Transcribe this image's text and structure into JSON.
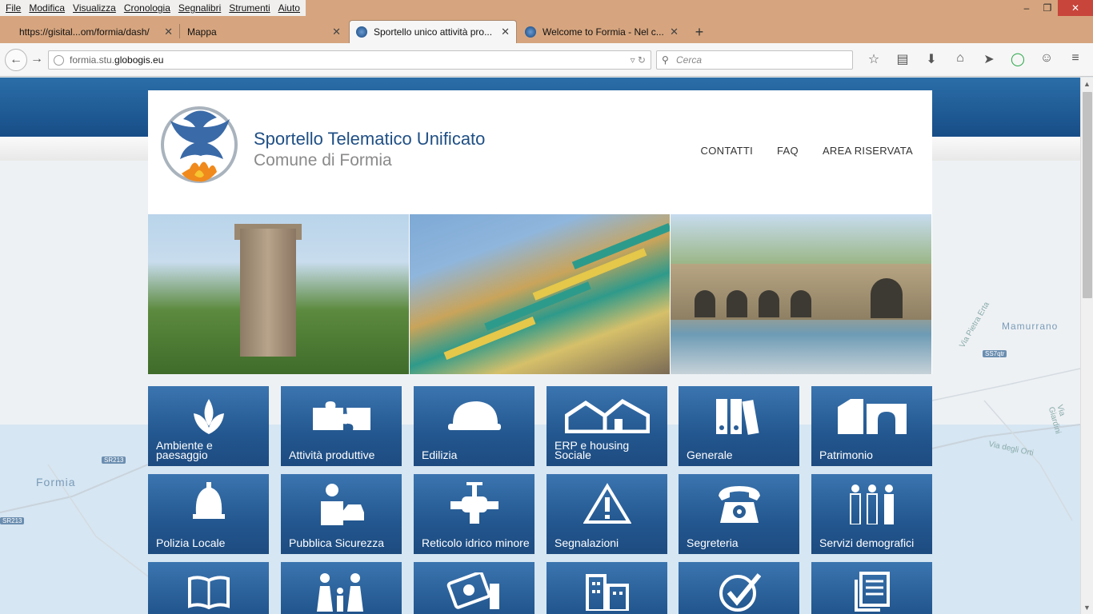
{
  "menu": [
    "File",
    "Modifica",
    "Visualizza",
    "Cronologia",
    "Segnalibri",
    "Strumenti",
    "Aiuto"
  ],
  "window_controls": {
    "minimize": "–",
    "maximize": "❐",
    "close": "✕"
  },
  "tabs": [
    {
      "title": "https://gisital...om/formia/dash/",
      "close": "✕"
    },
    {
      "title": "Mappa",
      "close": "✕"
    },
    {
      "title": "Sportello unico attività pro...",
      "close": "✕",
      "active": true
    },
    {
      "title": "Welcome to Formia - Nel c...",
      "close": "✕"
    }
  ],
  "newtab": "+",
  "nav": {
    "back": "←",
    "forward": "→",
    "url_prefix": "formia.stu.",
    "url_domain": "globogis.eu",
    "url_controls": "▿ ↻",
    "search_placeholder": "Cerca",
    "search_icon": "⚲",
    "toolbar_icons": [
      "☆",
      "▤",
      "⬇",
      "⌂",
      "➤",
      "◯",
      "☺",
      "≡"
    ]
  },
  "header": {
    "title": "Sportello Telematico Unificato",
    "subtitle": "Comune di Formia",
    "links": [
      "CONTATTI",
      "FAQ",
      "AREA RISERVATA"
    ]
  },
  "map_labels": {
    "formia": "Formia",
    "mamurrano": "Mamurrano",
    "via_degli_orti": "Via degli Orti",
    "via_pietra_erta": "Via Pietra Erta",
    "via_giardini": "Via Giardini",
    "sr213_a": "SR213",
    "sr213_b": "SR213",
    "ss7qtr": "SS7qtr"
  },
  "tiles": [
    {
      "label": "Ambiente e paesaggio",
      "icon": "leaves-icon"
    },
    {
      "label": "Attività produttive",
      "icon": "puzzle-icon"
    },
    {
      "label": "Edilizia",
      "icon": "helmet-icon"
    },
    {
      "label": "ERP e housing Sociale",
      "icon": "houses-icon"
    },
    {
      "label": "Generale",
      "icon": "binders-icon"
    },
    {
      "label": "Patrimonio",
      "icon": "monument-icon"
    },
    {
      "label": "Polizia Locale",
      "icon": "police-helmet-icon"
    },
    {
      "label": "Pubblica Sicurezza",
      "icon": "officer-car-icon"
    },
    {
      "label": "Reticolo idrico minore",
      "icon": "valve-icon"
    },
    {
      "label": "Segnalazioni",
      "icon": "warning-icon"
    },
    {
      "label": "Segreteria",
      "icon": "telephone-icon"
    },
    {
      "label": "Servizi demografici",
      "icon": "people-icon"
    },
    {
      "label": "",
      "icon": "book-icon"
    },
    {
      "label": "",
      "icon": "family-icon"
    },
    {
      "label": "",
      "icon": "money-icon"
    },
    {
      "label": "",
      "icon": "buildings-icon"
    },
    {
      "label": "",
      "icon": "checkmark-icon"
    },
    {
      "label": "",
      "icon": "document-icon"
    }
  ]
}
